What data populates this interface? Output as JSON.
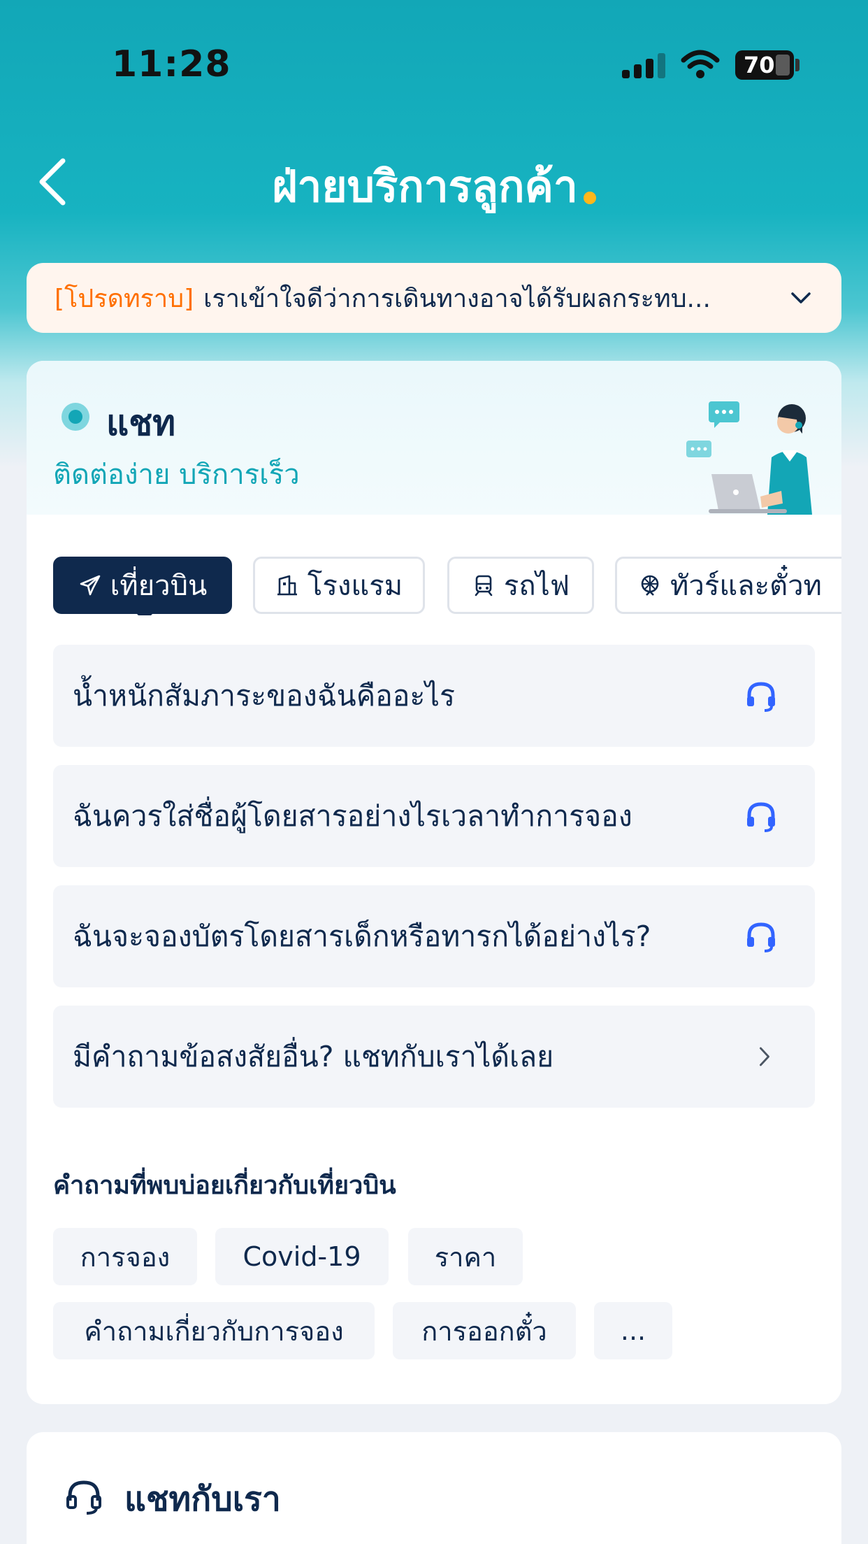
{
  "status_bar": {
    "time": "11:28",
    "battery": "70"
  },
  "header": {
    "title": "ฝ่ายบริการลูกค้า"
  },
  "notice": {
    "tag": "[โปรดทราบ]",
    "text": "เราเข้าใจดีว่าการเดินทางอาจได้รับผลกระทบ..."
  },
  "chat": {
    "title": "แชท",
    "subtitle": "ติดต่อง่าย บริการเร็ว",
    "tabs": [
      {
        "label": "เที่ยวบิน",
        "icon": "plane-icon",
        "active": true
      },
      {
        "label": "โรงแรม",
        "icon": "hotel-icon",
        "active": false
      },
      {
        "label": "รถไฟ",
        "icon": "train-icon",
        "active": false
      },
      {
        "label": "ทัวร์และตั๋วท",
        "icon": "ferris-wheel-icon",
        "active": false
      }
    ],
    "questions": [
      {
        "text": "น้ำหนักสัมภาระของฉันคืออะไร",
        "icon": "headset-icon"
      },
      {
        "text": "ฉันควรใส่ชื่อผู้โดยสารอย่างไรเวลาทำการจอง",
        "icon": "headset-icon"
      },
      {
        "text": "ฉันจะจองบัตรโดยสารเด็กหรือทารกได้อย่างไร?",
        "icon": "headset-icon"
      },
      {
        "text": "มีคำถามข้อสงสัยอื่น? แชทกับเราได้เลย",
        "icon": "chevron-right-icon"
      }
    ],
    "faq_title": "คำถามที่พบบ่อยเกี่ยวกับเที่ยวบิน",
    "faq_chips": [
      "การจอง",
      "Covid-19",
      "ราคา",
      "คำถามเกี่ยวกับการจอง",
      "การออกตั๋ว",
      "..."
    ]
  },
  "contact": {
    "title": "แชทกับเรา",
    "icon": "headset-icon"
  },
  "colors": {
    "brand_teal": "#13a6b6",
    "navy": "#0f294d",
    "notice_orange": "#ff6f00",
    "accent_yellow": "#ffb71b",
    "headset_blue": "#3264ff"
  }
}
